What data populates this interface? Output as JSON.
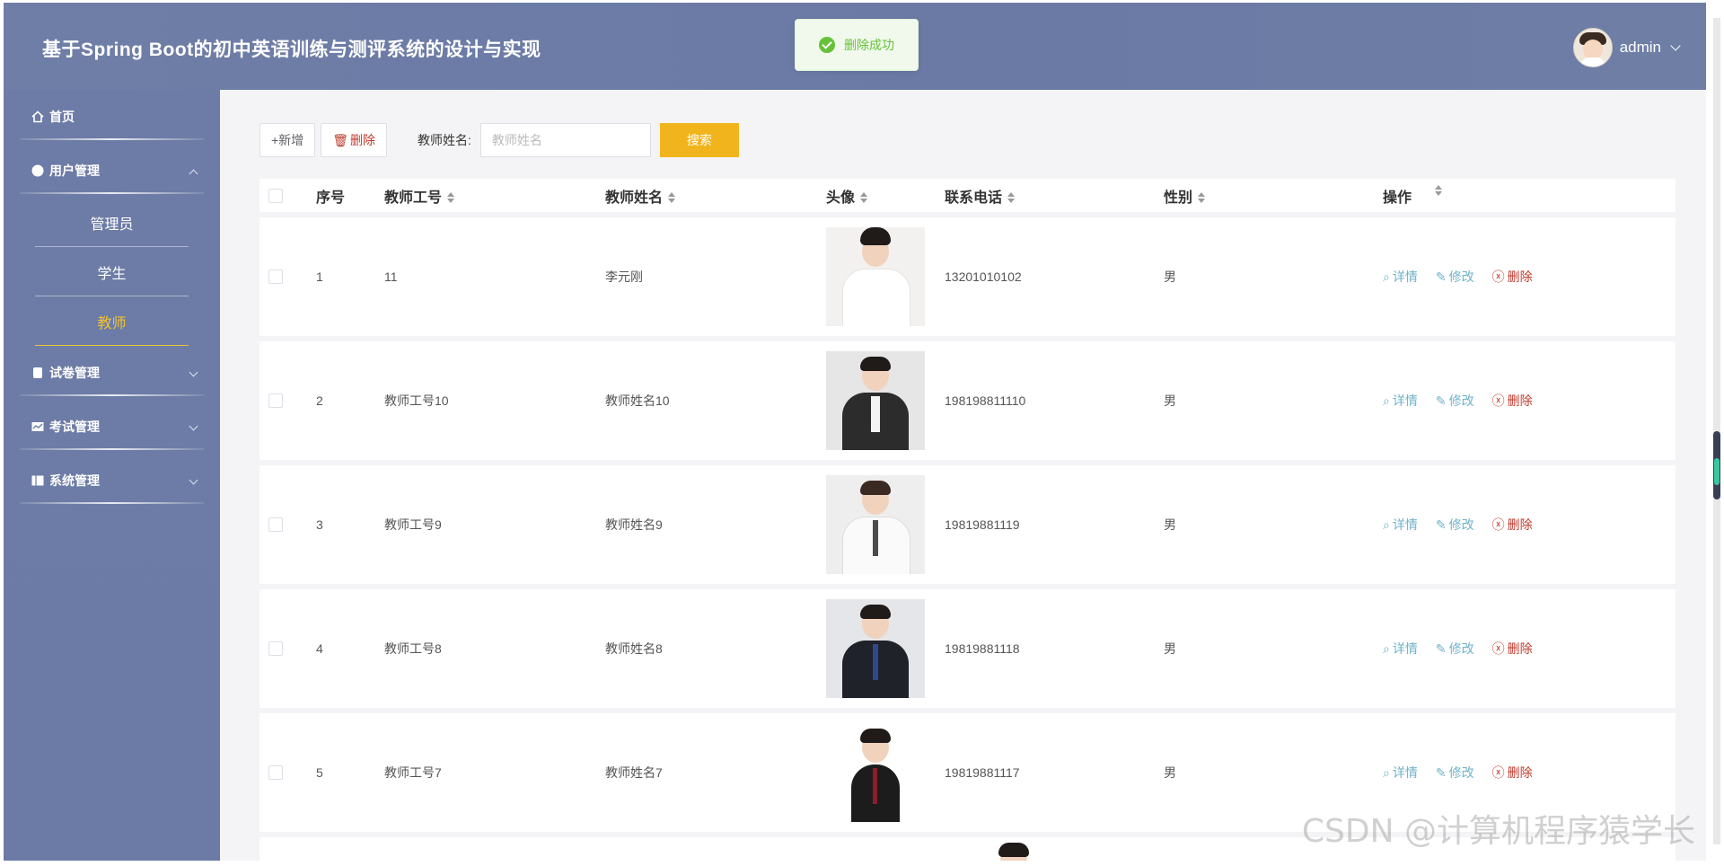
{
  "header": {
    "title": "基于Spring Boot的初中英语训练与测评系统的设计与实现",
    "user": "admin"
  },
  "toast": {
    "message": "删除成功"
  },
  "sidebar": {
    "items": [
      {
        "label": "首页",
        "icon": "home-icon"
      },
      {
        "label": "用户管理",
        "icon": "user-icon",
        "expanded": true
      },
      {
        "label": "试卷管理",
        "icon": "paper-icon"
      },
      {
        "label": "考试管理",
        "icon": "exam-icon"
      },
      {
        "label": "系统管理",
        "icon": "system-icon"
      }
    ],
    "sub_items": [
      {
        "label": "管理员"
      },
      {
        "label": "学生"
      },
      {
        "label": "教师",
        "active": true
      }
    ]
  },
  "toolbar": {
    "add_label": "+新增",
    "delete_label": "删除",
    "search_label": "教师姓名:",
    "search_placeholder": "教师姓名",
    "search_button": "搜索"
  },
  "table": {
    "headers": [
      "序号",
      "教师工号",
      "教师姓名",
      "头像",
      "联系电话",
      "性别",
      "操作"
    ],
    "rows": [
      {
        "index": "1",
        "no": "11",
        "name": "李元刚",
        "phone": "13201010102",
        "gender": "男"
      },
      {
        "index": "2",
        "no": "教师工号10",
        "name": "教师姓名10",
        "phone": "198198811110",
        "gender": "男"
      },
      {
        "index": "3",
        "no": "教师工号9",
        "name": "教师姓名9",
        "phone": "19819881119",
        "gender": "男"
      },
      {
        "index": "4",
        "no": "教师工号8",
        "name": "教师姓名8",
        "phone": "19819881118",
        "gender": "男"
      },
      {
        "index": "5",
        "no": "教师工号7",
        "name": "教师姓名7",
        "phone": "19819881117",
        "gender": "男"
      }
    ],
    "actions": {
      "detail": "详情",
      "edit": "修改",
      "delete": "删除"
    }
  },
  "watermark": "CSDN @计算机程序猿学长",
  "colors": {
    "accent": "#f1b41c",
    "header": "#6b7ba5",
    "link": "#6fb3c9",
    "danger": "#c0392b"
  }
}
